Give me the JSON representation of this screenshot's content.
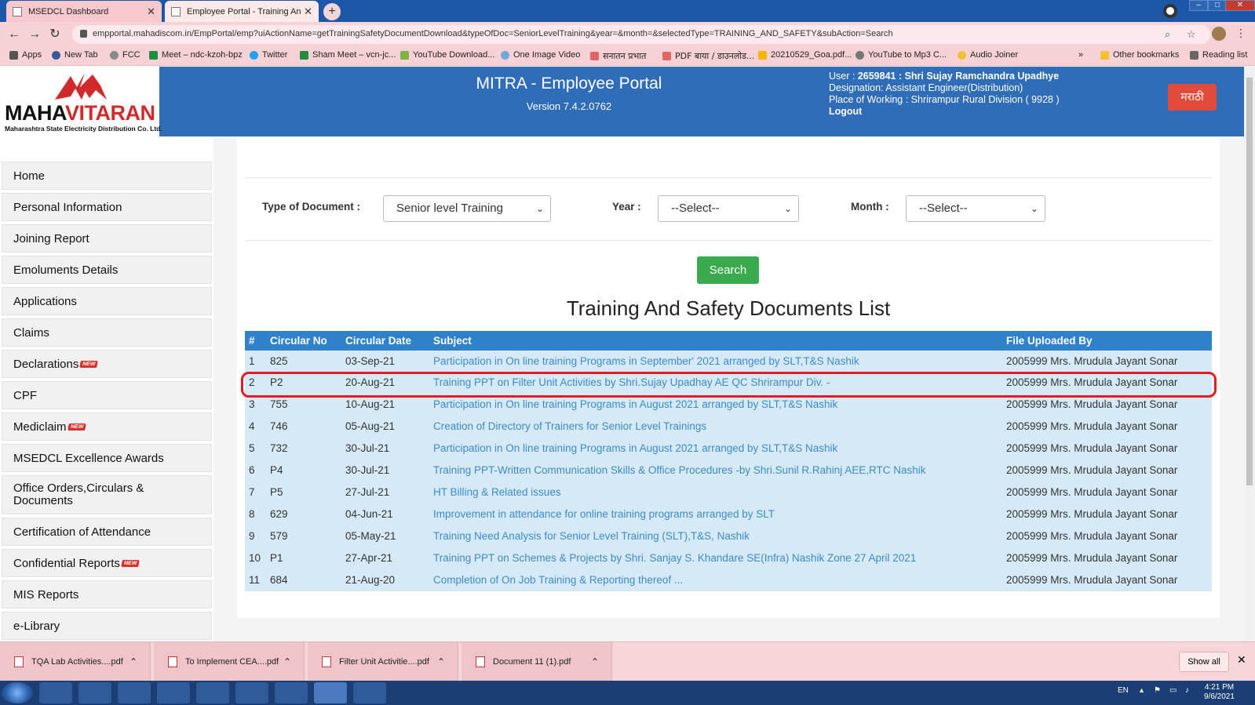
{
  "browser": {
    "tabs": [
      {
        "title": "MSEDCL Dashboard"
      },
      {
        "title": "Employee Portal - Training And S"
      }
    ],
    "url": "empportal.mahadiscom.in/EmpPortal/emp?uiActionName=getTrainingSafetyDocumentDownload&typeOfDoc=SeniorLevelTraining&year=&month=&selectedType=TRAINING_AND_SAFETY&subAction=Search",
    "bookmarks": [
      "Apps",
      "New Tab",
      "FCC",
      "Meet – ndc-kzoh-bpz",
      "Twitter",
      "Sham Meet – vcn-jc...",
      "YouTube Download...",
      "One Image Video",
      "सनातन प्रभात",
      "PDF बाया / डाउनलोड...",
      "20210529_Goa.pdf...",
      "YouTube to Mp3 C...",
      "Audio Joiner"
    ],
    "bookmarks_overflow": "»",
    "other_bookmarks": "Other bookmarks",
    "reading_list": "Reading list"
  },
  "header": {
    "logo_text_a": "MAHA",
    "logo_text_b": "VITARAN",
    "logo_sub": "Maharashtra State Electricity Distribution Co. Ltd.",
    "title": "MITRA - Employee Portal",
    "version": "Version 7.4.2.0762",
    "user_label": "User : ",
    "user_value": "2659841 : Shri Sujay Ramchandra Upadhye",
    "designation": "Designation: Assistant Engineer(Distribution)",
    "place": "Place of Working : Shrirampur Rural Division ( 9928 )",
    "logout": "Logout",
    "lang_button": "मराठी"
  },
  "sidebar": {
    "items": [
      {
        "label": "Home",
        "badge": ""
      },
      {
        "label": "Personal Information",
        "badge": ""
      },
      {
        "label": "Joining Report",
        "badge": ""
      },
      {
        "label": "Emoluments Details",
        "badge": ""
      },
      {
        "label": "Applications",
        "badge": ""
      },
      {
        "label": "Claims",
        "badge": ""
      },
      {
        "label": "Declarations",
        "badge": "NEW"
      },
      {
        "label": "CPF",
        "badge": ""
      },
      {
        "label": "Mediclaim",
        "badge": "NEW"
      },
      {
        "label": "MSEDCL Excellence Awards",
        "badge": ""
      },
      {
        "label": "Office Orders,Circulars & Documents",
        "badge": ""
      },
      {
        "label": "Certification of Attendance",
        "badge": ""
      },
      {
        "label": "Confidential Reports",
        "badge": "NEW"
      },
      {
        "label": "MIS Reports",
        "badge": ""
      },
      {
        "label": "e-Library",
        "badge": ""
      }
    ]
  },
  "filters": {
    "type_label": "Type of Document :",
    "type_value": "Senior level Training",
    "year_label": "Year :",
    "year_value": "--Select--",
    "month_label": "Month :",
    "month_value": "--Select--",
    "search_label": "Search"
  },
  "list": {
    "title": "Training And Safety Documents List",
    "columns": [
      "#",
      "Circular No",
      "Circular Date",
      "Subject",
      "File Uploaded By"
    ],
    "rows": [
      {
        "n": "1",
        "circ": "825",
        "date": "03-Sep-21",
        "subject": "Participation in On line training Programs in September' 2021 arranged by SLT,T&S Nashik",
        "by": "2005999 Mrs. Mrudula Jayant Sonar"
      },
      {
        "n": "2",
        "circ": "P2",
        "date": "20-Aug-21",
        "subject": "Training PPT on Filter Unit Activities by Shri.Sujay Upadhay AE QC Shrirampur Div. -",
        "by": "2005999 Mrs. Mrudula Jayant Sonar"
      },
      {
        "n": "3",
        "circ": "755",
        "date": "10-Aug-21",
        "subject": "Participation in On line training Programs in August 2021 arranged by SLT,T&S Nashik",
        "by": "2005999 Mrs. Mrudula Jayant Sonar"
      },
      {
        "n": "4",
        "circ": "746",
        "date": "05-Aug-21",
        "subject": "Creation of Directory of Trainers for Senior Level Trainings",
        "by": "2005999 Mrs. Mrudula Jayant Sonar"
      },
      {
        "n": "5",
        "circ": "732",
        "date": "30-Jul-21",
        "subject": "Participation in On line training Programs in August 2021 arranged by SLT,T&S Nashik",
        "by": "2005999 Mrs. Mrudula Jayant Sonar"
      },
      {
        "n": "6",
        "circ": "P4",
        "date": "30-Jul-21",
        "subject": "Training PPT-Written Communication Skills & Office Procedures -by Shri.Sunil R.Rahinj AEE,RTC Nashik",
        "by": "2005999 Mrs. Mrudula Jayant Sonar"
      },
      {
        "n": "7",
        "circ": "P5",
        "date": "27-Jul-21",
        "subject": "HT Billing & Related issues",
        "by": "2005999 Mrs. Mrudula Jayant Sonar"
      },
      {
        "n": "8",
        "circ": "629",
        "date": "04-Jun-21",
        "subject": "Improvement in attendance for online training programs arranged by SLT",
        "by": "2005999 Mrs. Mrudula Jayant Sonar"
      },
      {
        "n": "9",
        "circ": "579",
        "date": "05-May-21",
        "subject": "Training Need Analysis for Senior Level Training (SLT),T&S, Nashik",
        "by": "2005999 Mrs. Mrudula Jayant Sonar"
      },
      {
        "n": "10",
        "circ": "P1",
        "date": "27-Apr-21",
        "subject": "Training PPT on Schemes & Projects by Shri. Sanjay S. Khandare SE(Infra) Nashik Zone 27 April 2021",
        "by": "2005999 Mrs. Mrudula Jayant Sonar"
      },
      {
        "n": "11",
        "circ": "684",
        "date": "21-Aug-20",
        "subject": "Completion of On Job Training & Reporting thereof ...",
        "by": "2005999 Mrs. Mrudula Jayant Sonar"
      }
    ]
  },
  "downloads": {
    "items": [
      "TQA Lab Activities....pdf",
      "To Implement CEA....pdf",
      "Filter Unit Activitie....pdf",
      "Document 11 (1).pdf"
    ],
    "show_all": "Show all"
  },
  "taskbar": {
    "lang": "EN",
    "time": "4:21 PM",
    "date": "9/6/2021"
  },
  "colors": {
    "header_blue": "#2f6db8",
    "table_header": "#2f81c9",
    "link_blue": "#3d8bc9",
    "search_green": "#3aaa4e",
    "highlight_red": "#e31b23",
    "lang_red": "#e24a3a"
  }
}
